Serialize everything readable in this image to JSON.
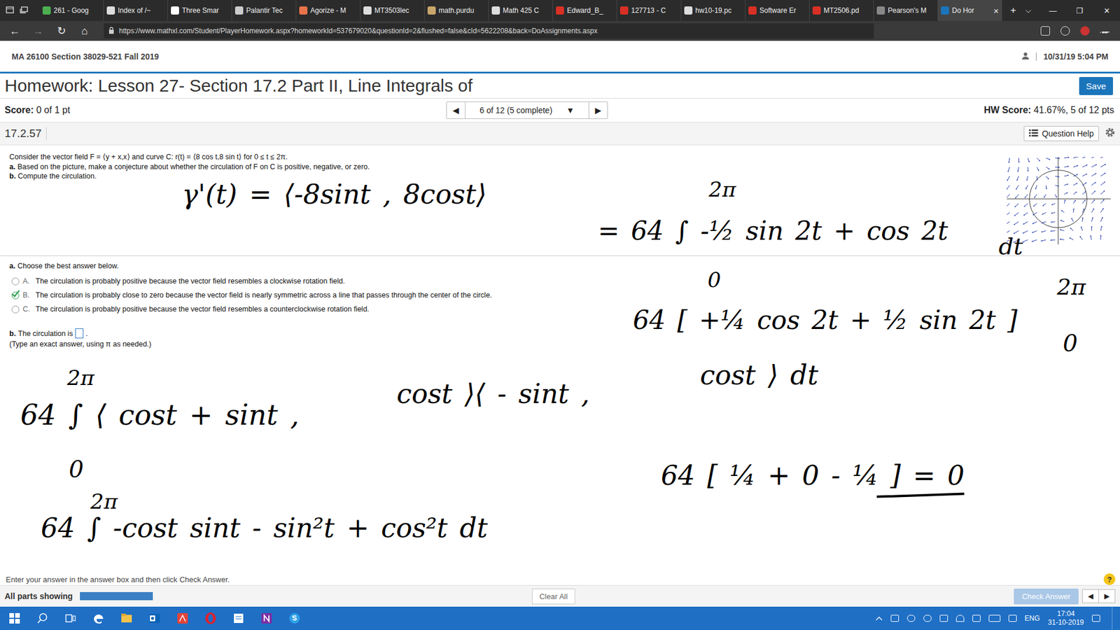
{
  "browser": {
    "tabs": [
      {
        "label": "261 - Goog",
        "selected": false,
        "color": "#4caf50"
      },
      {
        "label": "Index of /~",
        "selected": false,
        "color": "#dddddd"
      },
      {
        "label": "Three Smar",
        "selected": false,
        "color": "#ffffff"
      },
      {
        "label": "Palantir Tec",
        "selected": false,
        "color": "#cccccc"
      },
      {
        "label": "Agorize - M",
        "selected": false,
        "color": "#e8734a"
      },
      {
        "label": "MT3503lec",
        "selected": false,
        "color": "#dddddd"
      },
      {
        "label": "math.purdu",
        "selected": false,
        "color": "#c9a66b"
      },
      {
        "label": "Math 425 C",
        "selected": false,
        "color": "#dddddd"
      },
      {
        "label": "Edward_B_",
        "selected": false,
        "color": "#d93025"
      },
      {
        "label": "127713 - C",
        "selected": false,
        "color": "#d93025"
      },
      {
        "label": "hw10-19.pc",
        "selected": false,
        "color": "#dddddd"
      },
      {
        "label": "Software Er",
        "selected": false,
        "color": "#d93025"
      },
      {
        "label": "MT2506.pd",
        "selected": false,
        "color": "#d93025"
      },
      {
        "label": "Pearson's M",
        "selected": false,
        "color": "#888888"
      },
      {
        "label": "Do Hor",
        "selected": true,
        "color": "#1b75bb"
      }
    ],
    "tab_close": "×",
    "new_tab": "+",
    "tab_list": "⌵",
    "window_controls": [
      "—",
      "❐",
      "✕"
    ],
    "nav_buttons": [
      "←",
      "→",
      "↻",
      "⌂"
    ],
    "url": "https://www.mathxl.com/Student/PlayerHomework.aspx?homeworkId=537679020&questionId=2&flushed=false&cId=5622208&back=DoAssignments.aspx"
  },
  "page": {
    "course": "MA 26100 Section 38029-521 Fall 2019",
    "datetime": "10/31/19 5:04 PM",
    "title": "Homework: Lesson 27- Section 17.2 Part II, Line Integrals of",
    "save": "Save",
    "score_label": "Score:",
    "score": "0 of 1 pt",
    "nav_prev": "◀",
    "nav_label": "6 of 12 (5 complete)",
    "nav_caret": "▼",
    "nav_next": "▶",
    "hw_score_label": "HW Score:",
    "hw_score": "41.67%, 5 of 12 pts",
    "question_id": "17.2.57",
    "question_help": "Question Help",
    "question": [
      {
        "label": "",
        "text": "Consider the vector field F = ⟨y + x,x⟩ and curve C: r(t) = ⟨8 cos t,8 sin t⟩ for 0 ≤ t ≤ 2π."
      },
      {
        "label": "a.",
        "text": "Based on the picture, make a conjecture about whether the circulation of F on C is positive, negative, or zero."
      },
      {
        "label": "b.",
        "text": "Compute the circulation."
      }
    ],
    "part_a": {
      "label": "a.",
      "prompt": "Choose the best answer below.",
      "options": [
        {
          "letter": "A.",
          "text": "The circulation is probably positive because the vector field resembles a clockwise rotation field.",
          "selected": false
        },
        {
          "letter": "B.",
          "text": "The circulation is probably close to zero because the vector field is nearly symmetric across a line that passes through the center of the circle.",
          "selected": true
        },
        {
          "letter": "C.",
          "text": "The circulation is probably positive because the vector field resembles a counterclockwise rotation field.",
          "selected": false
        }
      ]
    },
    "part_b": {
      "label": "b.",
      "prefix": "The circulation is",
      "answer": "",
      "suffix": ".",
      "hint": "(Type an exact answer, using π as needed.)"
    },
    "footer": {
      "hint": "Enter your answer in the answer box and then click Check Answer.",
      "help": "?",
      "all_parts": "All parts showing",
      "parts_level": 1,
      "clear": "Clear All",
      "check": {
        "label": "Check Answer",
        "disabled": true
      },
      "prev": "◀",
      "next": "▶"
    }
  },
  "ink": [
    {
      "text": "γ'(t) = ⟨-8sint , 8cost⟩",
      "underlined": false
    },
    {
      "text": "2π",
      "underlined": false
    },
    {
      "text": "= 64 ∫ -½ sin 2t + cos 2t",
      "underlined": false
    },
    {
      "text": "dt",
      "underlined": false
    },
    {
      "text": "0",
      "underlined": false
    },
    {
      "text": "64 [ +¼ cos 2t + ½ sin 2t ]",
      "underlined": false
    },
    {
      "text": "2π",
      "underlined": false
    },
    {
      "text": "0",
      "underlined": false
    },
    {
      "text": "2π",
      "underlined": false
    },
    {
      "text": "64 ∫ ⟨ cost + sint ,",
      "underlined": false
    },
    {
      "text": "cost ⟩⟨ - sint ,",
      "underlined": false
    },
    {
      "text": "cost ⟩ dt",
      "underlined": false
    },
    {
      "text": "0",
      "underlined": false
    },
    {
      "text": "64 [ ¼ + 0 - ¼ ] = 0",
      "underlined": true
    },
    {
      "text": "2π",
      "underlined": false
    },
    {
      "text": "64 ∫ -cost sint - sin²t + cos²t dt",
      "underlined": false
    }
  ],
  "taskbar": {
    "lang": "ENG",
    "time": "17:04",
    "date": "31-10-2019"
  }
}
